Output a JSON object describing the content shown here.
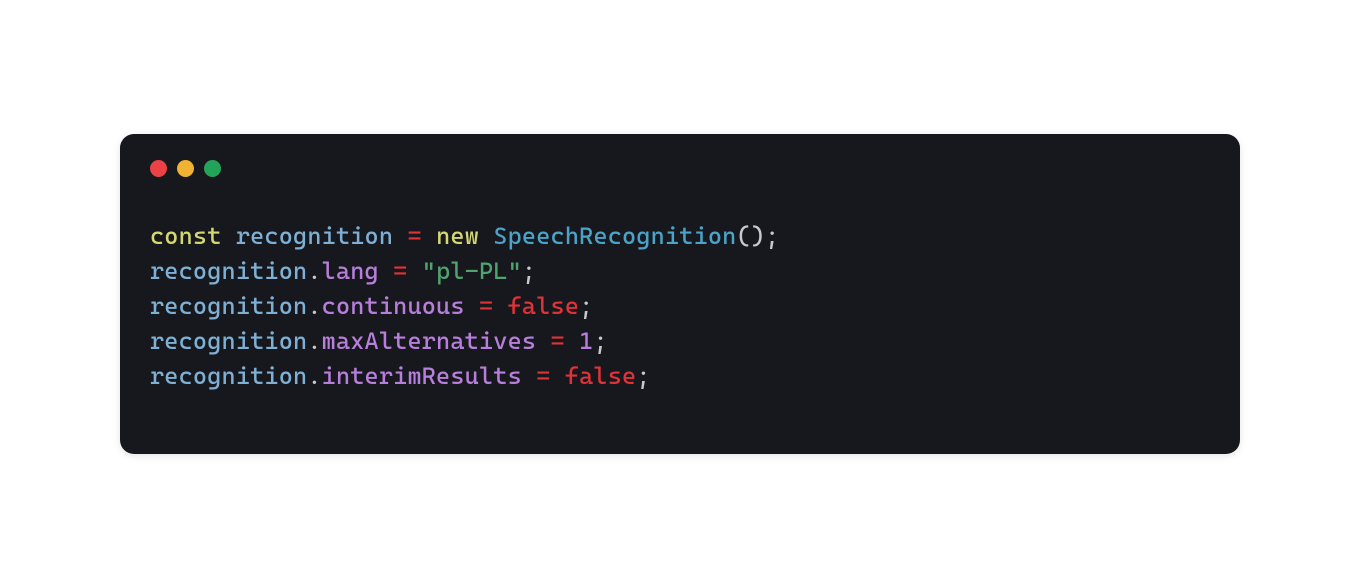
{
  "code": {
    "line1": {
      "keyword": "const",
      "variable": "recognition",
      "eq": "=",
      "new": "new",
      "class": "SpeechRecognition",
      "parens": "();"
    },
    "line2": {
      "variable": "recognition",
      "dot": ".",
      "property": "lang",
      "eq": "=",
      "string": "\"pl-PL\"",
      "semi": ";"
    },
    "line3": {
      "variable": "recognition",
      "dot": ".",
      "property": "continuous",
      "eq": "=",
      "bool": "false",
      "semi": ";"
    },
    "line4": {
      "variable": "recognition",
      "dot": ".",
      "property": "maxAlternatives",
      "eq": "=",
      "number": "1",
      "semi": ";"
    },
    "line5": {
      "variable": "recognition",
      "dot": ".",
      "property": "interimResults",
      "eq": "=",
      "bool": "false",
      "semi": ";"
    }
  },
  "colors": {
    "background": "#17181d",
    "red": "#ed4245",
    "yellow": "#f0b232",
    "green": "#23a559"
  }
}
